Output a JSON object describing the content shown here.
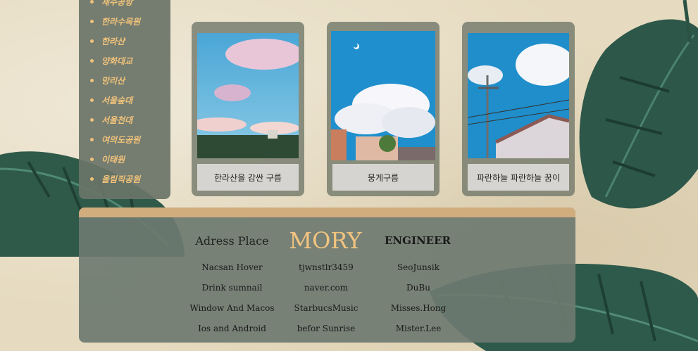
{
  "sidebar": {
    "items": [
      {
        "label": "제주공항"
      },
      {
        "label": "한라수목원"
      },
      {
        "label": "한라산"
      },
      {
        "label": "양화대교"
      },
      {
        "label": "망리산"
      },
      {
        "label": "서울숲대"
      },
      {
        "label": "서울천대"
      },
      {
        "label": "여의도공원"
      },
      {
        "label": "이태원"
      },
      {
        "label": "올림픽공원"
      }
    ]
  },
  "cards": [
    {
      "caption": "한라산을 감싼 구름"
    },
    {
      "caption": "뭉게구름"
    },
    {
      "caption": "파란하늘 파란하늘 꿈이"
    }
  ],
  "footer": {
    "adress_heading": "Adress Place",
    "logo": "MORY",
    "engineer_heading": "ENGINEER",
    "col1": [
      "Nacsan Hover",
      "Drink sumnail",
      "Window And Macos",
      "Ios and Android"
    ],
    "col2": [
      "tjwnstlr3459",
      "naver.com",
      "StarbucsMusic",
      "befor Sunrise"
    ],
    "col3": [
      "SeoJunsik",
      "DuBu",
      "Misses.Hong",
      "Mister.Lee"
    ]
  },
  "colors": {
    "accent": "#f2c47f",
    "panel": "#6a7468",
    "footer_bar": "#d1ad7e",
    "background": "#e6dbc0"
  }
}
